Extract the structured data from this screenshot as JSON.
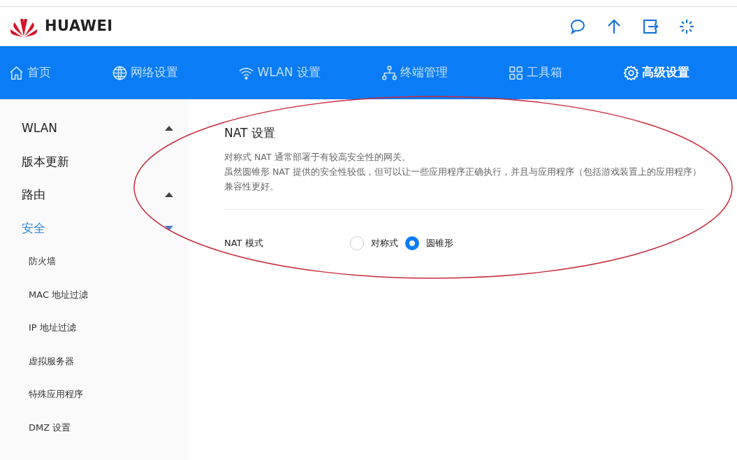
{
  "header": {
    "brand": "HUAWEI"
  },
  "nav_tabs": [
    {
      "label": "首页",
      "selected": false
    },
    {
      "label": "网络设置",
      "selected": false
    },
    {
      "label": "WLAN 设置",
      "selected": false
    },
    {
      "label": "终端管理",
      "selected": false
    },
    {
      "label": "工具箱",
      "selected": false
    },
    {
      "label": "高级设置",
      "selected": true
    }
  ],
  "sidebar": {
    "items": [
      {
        "label": "WLAN",
        "kind": "group",
        "expanded": false,
        "selected": false
      },
      {
        "label": "版本更新",
        "kind": "link",
        "selected": false
      },
      {
        "label": "路由",
        "kind": "group",
        "expanded": false,
        "selected": false
      },
      {
        "label": "安全",
        "kind": "group",
        "expanded": true,
        "selected": true,
        "children": [
          {
            "label": "防火墙",
            "selected": false
          },
          {
            "label": "MAC 地址过滤",
            "selected": false
          },
          {
            "label": "IP 地址过滤",
            "selected": false
          },
          {
            "label": "虚拟服务器",
            "selected": false
          },
          {
            "label": "特殊应用程序",
            "selected": false
          },
          {
            "label": "DMZ 设置",
            "selected": false
          }
        ]
      }
    ]
  },
  "section": {
    "title": "NAT 设置",
    "description": [
      "对称式 NAT 通常部署于有较高安全性的网关。",
      "虽然圆锥形 NAT 提供的安全性较低，但可以让一些应用程序正确执行，并且与应用程序（包括游戏装置上的应用程序）兼容性更好。"
    ],
    "field": {
      "label": "NAT 模式",
      "options": [
        {
          "label": "对称式",
          "selected": false
        },
        {
          "label": "圆锥形",
          "selected": true
        }
      ]
    }
  }
}
